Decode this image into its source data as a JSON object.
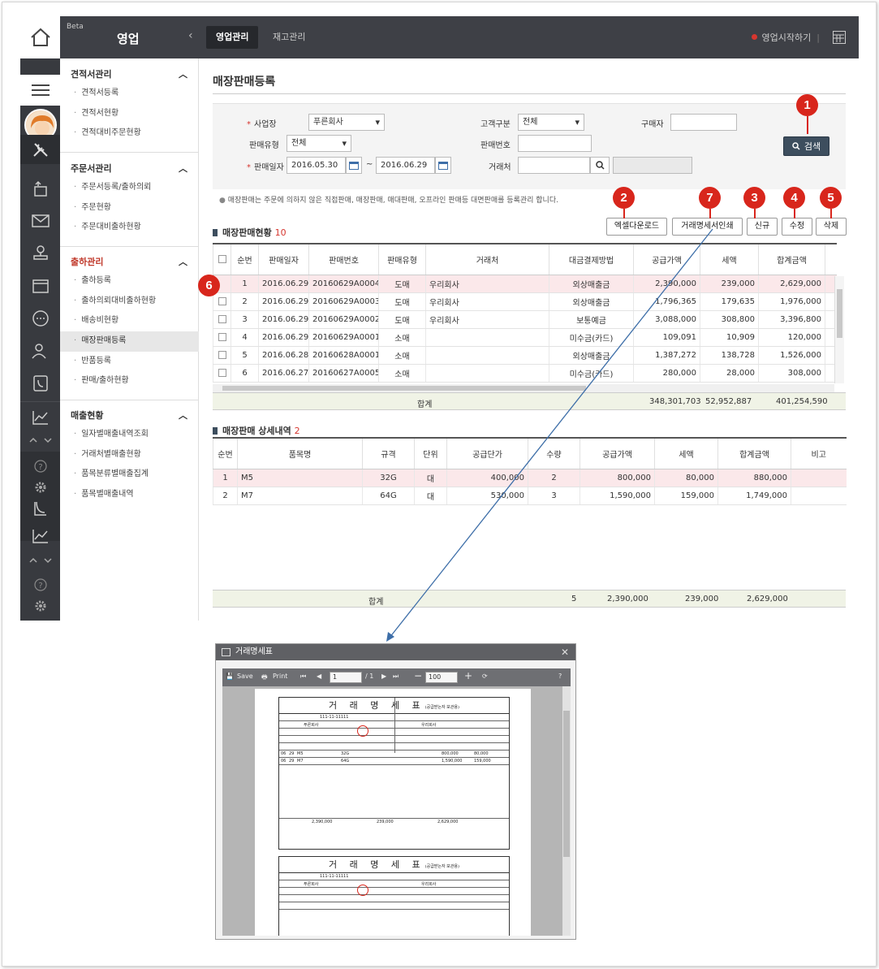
{
  "header": {
    "beta": "Beta",
    "app_title": "영업",
    "tabs": [
      {
        "label": "영업관리",
        "active": true
      },
      {
        "label": "재고관리",
        "active": false
      }
    ],
    "status": "영업시작하기",
    "status_sep": "|"
  },
  "sidebar": {
    "groups": [
      {
        "title": "견적서관리",
        "items": [
          "견적서등록",
          "견적서현황",
          "견적대비주문현황"
        ]
      },
      {
        "title": "주문서관리",
        "items": [
          "주문서등록/출하의뢰",
          "주문현황",
          "주문대비출하현황"
        ]
      },
      {
        "title": "출하관리",
        "items": [
          "출하등록",
          "출하의뢰대비출하현황",
          "배송비현황",
          "매장판매등록",
          "반품등록",
          "판매/출하현황"
        ],
        "active_item": "매장판매등록"
      },
      {
        "title": "매출현황",
        "items": [
          "일자별매출내역조회",
          "거래처별매출현황",
          "품목분류별매출집계",
          "품목별매출내역"
        ]
      }
    ]
  },
  "page": {
    "title": "매장판매등록"
  },
  "search": {
    "business_label": "사업장",
    "business_value": "푸른회사",
    "customer_type_label": "고객구분",
    "customer_type_value": "전체",
    "buyer_label": "구매자",
    "buyer_value": "",
    "sale_type_label": "판매유형",
    "sale_type_value": "전체",
    "sale_no_label": "판매번호",
    "sale_no_value": "",
    "sale_date_label": "판매일자",
    "date_from": "2016.05.30",
    "date_sep": "~",
    "date_to": "2016.06.29",
    "client_label": "거래처",
    "client_value": "",
    "search_button": "검색",
    "note": "매장판매는 주문에 의하지 않은 직접판매, 매장판매, 매대판매, 오프라인 판매등 대면판매를 등록관리 합니다."
  },
  "actions": {
    "excel": "엑셀다운로드",
    "print": "거래명세서인쇄",
    "new": "신규",
    "edit": "수정",
    "delete": "삭제"
  },
  "badges": [
    "1",
    "2",
    "3",
    "4",
    "5",
    "6",
    "7"
  ],
  "sales": {
    "title": "매장판매현황",
    "count": "10",
    "columns": [
      "순번",
      "판매일자",
      "판매번호",
      "판매유형",
      "거래처",
      "대금결제방법",
      "공급가액",
      "세액",
      "합계금액"
    ],
    "rows": [
      [
        "1",
        "2016.06.29",
        "20160629A0004",
        "도매",
        "우리회사",
        "외상매출금",
        "2,390,000",
        "239,000",
        "2,629,000"
      ],
      [
        "2",
        "2016.06.29",
        "20160629A0003",
        "도매",
        "우리회사",
        "외상매출금",
        "1,796,365",
        "179,635",
        "1,976,000"
      ],
      [
        "3",
        "2016.06.29",
        "20160629A0002",
        "도매",
        "우리회사",
        "보통예금",
        "3,088,000",
        "308,800",
        "3,396,800"
      ],
      [
        "4",
        "2016.06.29",
        "20160629A0001",
        "소매",
        "",
        "미수금(카드)",
        "109,091",
        "10,909",
        "120,000"
      ],
      [
        "5",
        "2016.06.28",
        "20160628A0001",
        "소매",
        "",
        "외상매출금",
        "1,387,272",
        "138,728",
        "1,526,000"
      ],
      [
        "6",
        "2016.06.27",
        "20160627A0005",
        "소매",
        "",
        "미수금(카드)",
        "280,000",
        "28,000",
        "308,000"
      ]
    ],
    "selected_row": 0,
    "total_label": "합계",
    "total_supply": "348,301,703",
    "total_tax": "52,952,887",
    "total_sum": "401,254,590"
  },
  "detail": {
    "title": "매장판매 상세내역",
    "count": "2",
    "columns": [
      "순번",
      "품목명",
      "규격",
      "단위",
      "공급단가",
      "수량",
      "공급가액",
      "세액",
      "합계금액",
      "비고"
    ],
    "rows": [
      [
        "1",
        "M5",
        "32G",
        "대",
        "400,000",
        "2",
        "800,000",
        "80,000",
        "880,000",
        ""
      ],
      [
        "2",
        "M7",
        "64G",
        "대",
        "530,000",
        "3",
        "1,590,000",
        "159,000",
        "1,749,000",
        ""
      ]
    ],
    "total_label": "합계",
    "total_qty": "5",
    "total_supply": "2,390,000",
    "total_tax": "239,000",
    "total_sum": "2,629,000"
  },
  "popup": {
    "title": "거래명세표",
    "save": "Save",
    "print": "Print",
    "page": "1",
    "page_total": "/ 1",
    "zoom": "100",
    "doc_title": "거 래 명 세 표",
    "doc_subtitle": "(공급받는자 보관용)",
    "reg_no": "111-11-11111",
    "company": "푸른회사",
    "client": "우리회사",
    "doc_rows": [
      [
        "06",
        "29",
        "M5",
        "32G",
        "800,000",
        "80,000"
      ],
      [
        "06",
        "29",
        "M7",
        "64G",
        "1,590,000",
        "159,000"
      ]
    ],
    "doc_supply": "2,390,000",
    "doc_tax": "239,000",
    "doc_sum": "2,629,000"
  },
  "colors": {
    "accent_red": "#d8261c",
    "dark_header": "#3e4046",
    "search_btn": "#3d4e5e",
    "selected_row": "#fbe8ea",
    "total_row": "#f0f3e6"
  }
}
